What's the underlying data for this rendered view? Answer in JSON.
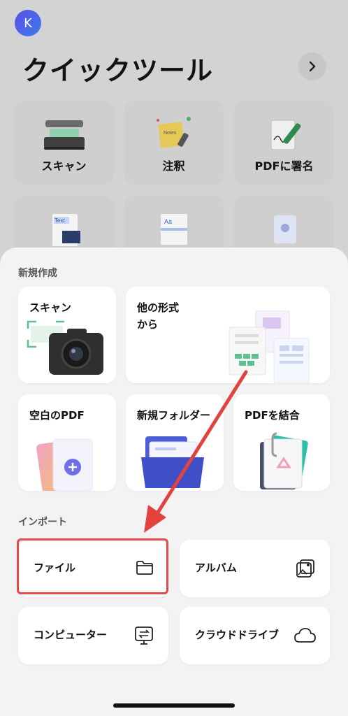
{
  "avatar": {
    "initial": "K"
  },
  "header": {
    "title": "クイックツール"
  },
  "quick_tools": [
    {
      "label": "スキャン",
      "icon": "scanner-icon"
    },
    {
      "label": "注釈",
      "icon": "notes-icon"
    },
    {
      "label": "PDFに署名",
      "icon": "signature-icon"
    },
    {
      "label": "",
      "icon": "text-image-icon"
    },
    {
      "label": "",
      "icon": "document-icon"
    },
    {
      "label": "",
      "icon": "image-file-icon"
    }
  ],
  "sheet": {
    "new_section": "新規作成",
    "new_items": {
      "scan": "スキャン",
      "other_format": [
        "他の形式",
        "から"
      ],
      "blank_pdf": "空白のPDF",
      "new_folder": "新規フォルダー",
      "merge_pdf": "PDFを結合"
    },
    "import_section": "インポート",
    "import_items": {
      "file": "ファイル",
      "album": "アルバム",
      "computer": "コンピューター",
      "cloud": "クラウドドライブ"
    }
  },
  "colors": {
    "highlight": "#e24b4b",
    "accent": "#5b5fe8"
  }
}
